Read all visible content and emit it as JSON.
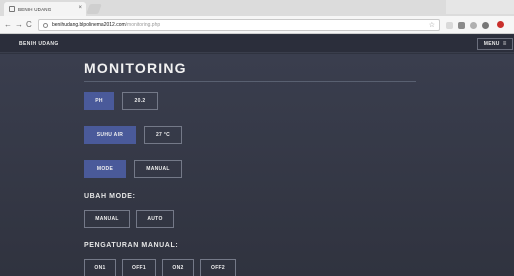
{
  "browser": {
    "tab_title": "BENIH UDANG",
    "url_host": "benihudang.blpolinema2012.com",
    "url_path": "/monitoring.php",
    "back_glyph": "←",
    "forward_glyph": "→",
    "reload_glyph": "C",
    "tab_close_glyph": "×",
    "star_glyph": "☆"
  },
  "header": {
    "brand": "BENIH UDANG",
    "menu_label": "MENU",
    "menu_icon": "≡"
  },
  "page": {
    "title": "MONITORING"
  },
  "readings": {
    "ph_label": "PH",
    "ph_value": "20.2",
    "temp_label": "SUHU AIR",
    "temp_value": "27 °C",
    "mode_label": "MODE",
    "mode_value": "MANUAL"
  },
  "change_mode": {
    "label": "UBAH MODE:",
    "manual_button": "MANUAL",
    "auto_button": "AUTO"
  },
  "manual_settings": {
    "label": "PENGATURAN MANUAL:",
    "buttons": [
      "ON1",
      "OFF1",
      "ON2",
      "OFF2"
    ]
  },
  "colors": {
    "accent": "#4a5a9a",
    "background": "#30333f",
    "header": "#2b2e3b"
  }
}
